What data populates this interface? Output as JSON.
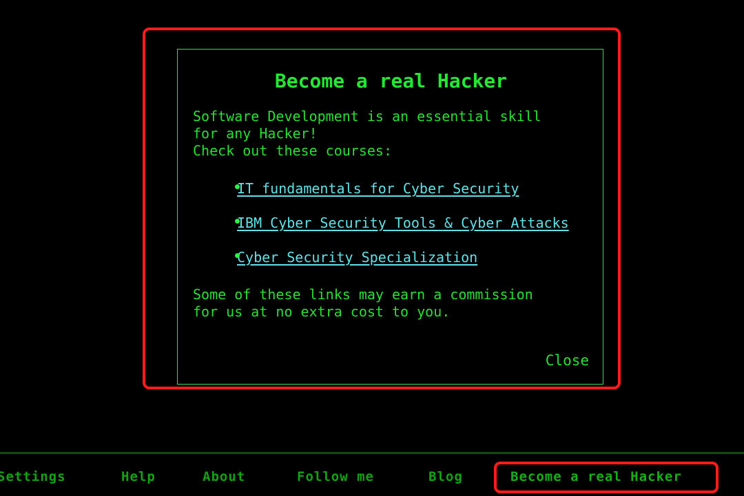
{
  "theme": {
    "background": "#000000",
    "green": "#27e033",
    "bright_green": "#23e635",
    "link_cyan": "#5fe3e8",
    "highlight_red": "#fe1b1b",
    "nav_green": "#11a312",
    "modal_border_green": "#33dd55"
  },
  "modal": {
    "title": "Become a real Hacker",
    "intro": [
      "Software Development is an essential skill",
      "for any Hacker!",
      "Check out these courses:"
    ],
    "courses": [
      {
        "label": "IT fundamentals for Cyber Security"
      },
      {
        "label": "IBM Cyber Security Tools & Cyber Attacks"
      },
      {
        "label": "Cyber Security Specialization"
      }
    ],
    "disclaimer": [
      "Some of these links may earn a commission",
      "for us at no extra cost to you."
    ],
    "close_label": "Close"
  },
  "bottom_nav": {
    "items": [
      {
        "label": "Settings"
      },
      {
        "label": "Help"
      },
      {
        "label": "About"
      },
      {
        "label": "Follow me"
      },
      {
        "label": "Blog"
      },
      {
        "label": "Become a real Hacker"
      }
    ]
  }
}
